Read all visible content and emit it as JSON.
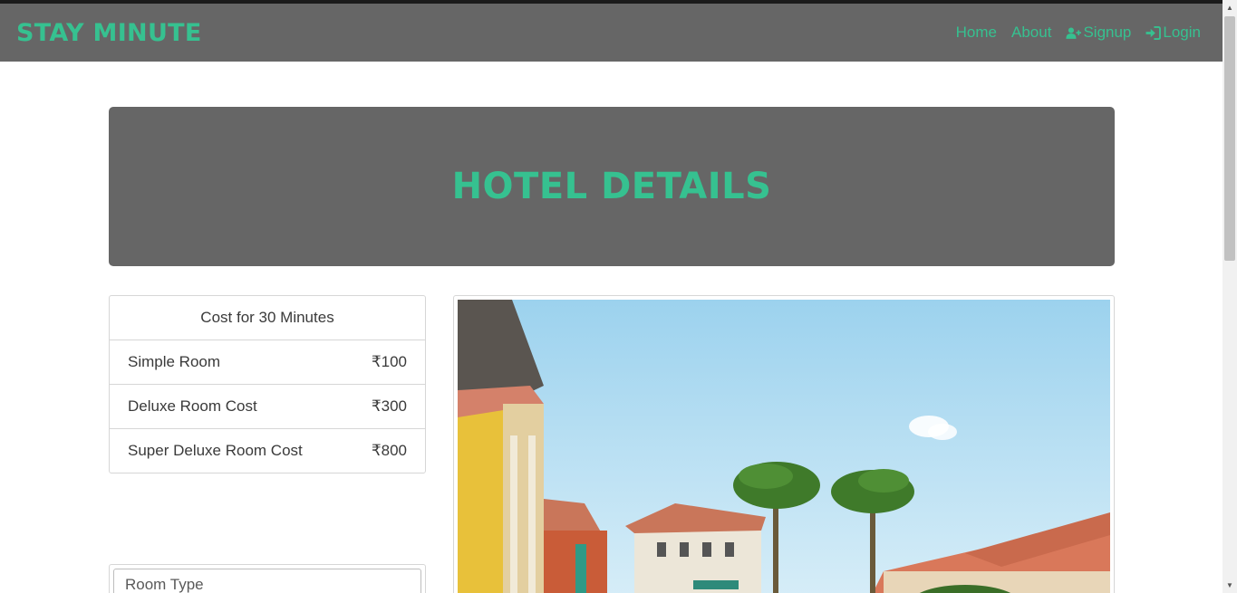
{
  "navbar": {
    "brand": "STAY MINUTE",
    "links": [
      {
        "label": "Home",
        "icon": ""
      },
      {
        "label": "About",
        "icon": ""
      },
      {
        "label": "Signup",
        "icon": "user-plus-icon"
      },
      {
        "label": "Login",
        "icon": "sign-in-icon"
      }
    ]
  },
  "hero": {
    "title": "HOTEL DETAILS"
  },
  "pricing": {
    "heading": "Cost for 30 Minutes",
    "rows": [
      {
        "name": "Simple Room",
        "price": "₹100"
      },
      {
        "name": "Deluxe Room Cost",
        "price": "₹300"
      },
      {
        "name": "Super Deluxe Room Cost",
        "price": "₹800"
      }
    ]
  },
  "booking": {
    "room_type_placeholder": "Room Type"
  },
  "colors": {
    "accent": "#36c190",
    "nav_bg": "#666666",
    "hero_bg": "#666666"
  }
}
